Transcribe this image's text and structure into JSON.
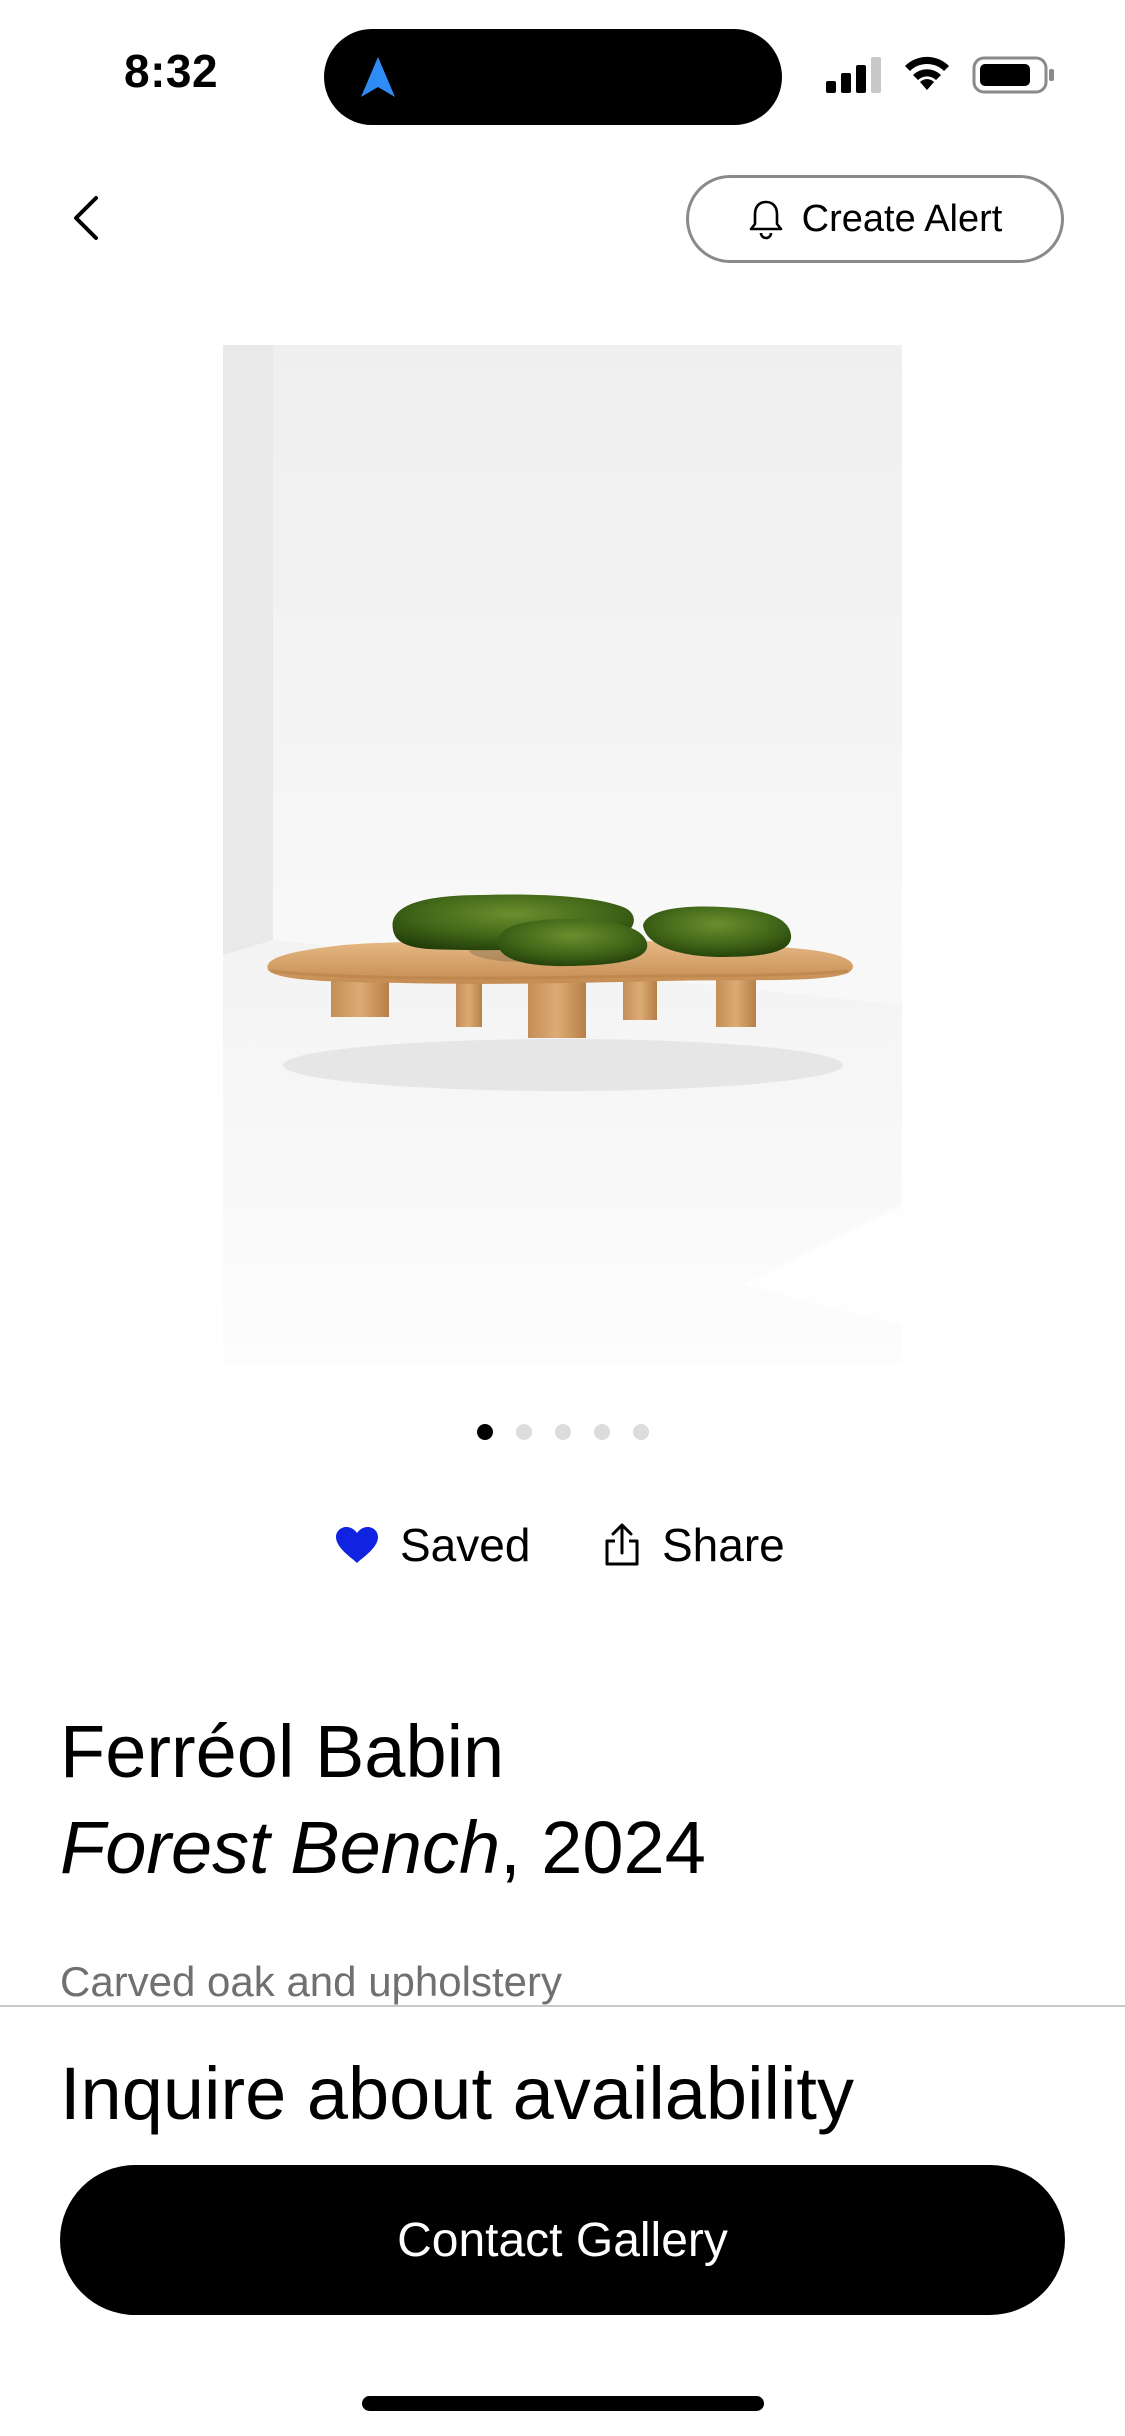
{
  "status_bar": {
    "time": "8:32"
  },
  "header": {
    "create_alert_label": "Create Alert"
  },
  "artwork_image": {
    "description_icon": "forest-bench-photo",
    "dots_count": 5,
    "active_dot": 1
  },
  "actions": {
    "saved_label": "Saved",
    "share_label": "Share",
    "saved_color": "#1023e0"
  },
  "artwork": {
    "artist": "Ferréol Babin",
    "title": "Forest Bench",
    "year_suffix": ", 2024",
    "medium": "Carved oak and upholstery"
  },
  "bottom_sheet": {
    "heading": "Inquire about availability",
    "contact_label": "Contact Gallery"
  }
}
